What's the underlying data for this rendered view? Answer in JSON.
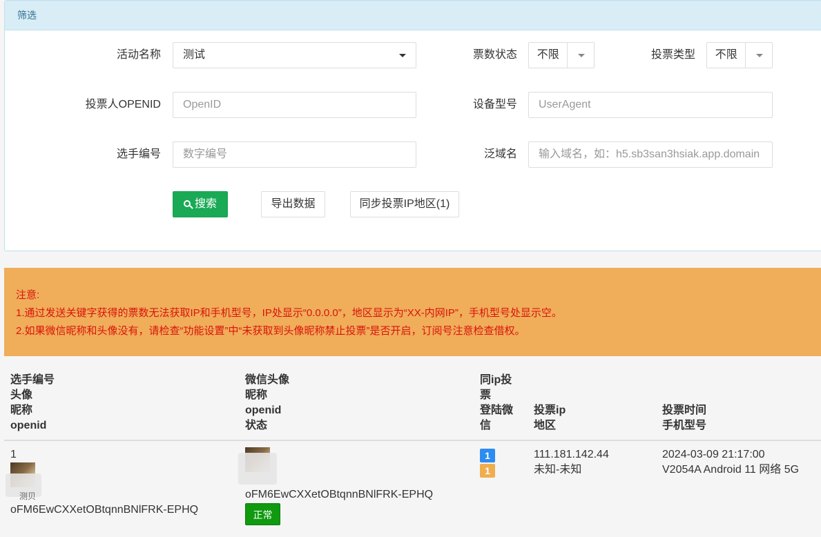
{
  "filter": {
    "heading": "筛选",
    "activity_label": "活动名称",
    "activity_value": "测试",
    "vote_status_label": "票数状态",
    "vote_status_value": "不限",
    "vote_type_label": "投票类型",
    "vote_type_value": "不限",
    "openid_label": "投票人OPENID",
    "openid_placeholder": "OpenID",
    "device_label": "设备型号",
    "device_placeholder": "UserAgent",
    "player_label": "选手编号",
    "player_placeholder": "数字编号",
    "domain_label": "泛域名",
    "domain_placeholder": "输入域名，如：h5.sb3san3hsiak.app.domain",
    "search_btn": "搜索",
    "export_btn": "导出数据",
    "sync_btn": "同步投票IP地区(1)"
  },
  "notice": {
    "title": "注意:",
    "line1": "1.通过发送关键字获得的票数无法获取IP和手机型号，IP处显示“0.0.0.0”，地区显示为“XX-内网IP”，手机型号处显示空。",
    "line2": "2.如果微信昵称和头像没有，请检查“功能设置”中“未获取到头像昵称禁止投票”是否开启，订阅号注意检查借权。"
  },
  "table": {
    "headers": {
      "col1": [
        "选手编号",
        "头像",
        "昵称",
        "openid"
      ],
      "col2": [
        "微信头像",
        "昵称",
        "openid",
        "状态"
      ],
      "col3": [
        "同ip投",
        "票",
        "登陆微",
        "信"
      ],
      "col4": [
        "投票ip",
        "地区"
      ],
      "col5": [
        "投票时间",
        "手机型号"
      ]
    },
    "rows": [
      {
        "player_no": "1",
        "player_nick": "测贝",
        "player_openid": "oFM6EwCXXetOBtqnnBNlFRK-EPHQ",
        "voter_openid": "oFM6EwCXXetOBtqnnBNlFRK-EPHQ",
        "status": "正常",
        "same_ip_count": "1",
        "login_wechat_count": "1",
        "ip": "111.181.142.44",
        "region": "未知-未知",
        "time": "2024-03-09 21:17:00",
        "device": "V2054A Android 11 网络 5G"
      }
    ]
  },
  "colors": {
    "primary": "#1aaa55",
    "notice_bg": "#f0ad5a",
    "notice_text": "#d9140a",
    "badge_blue": "#2d8cf0",
    "badge_orange": "#f0ad4e",
    "status_green": "#0f9a0f"
  }
}
